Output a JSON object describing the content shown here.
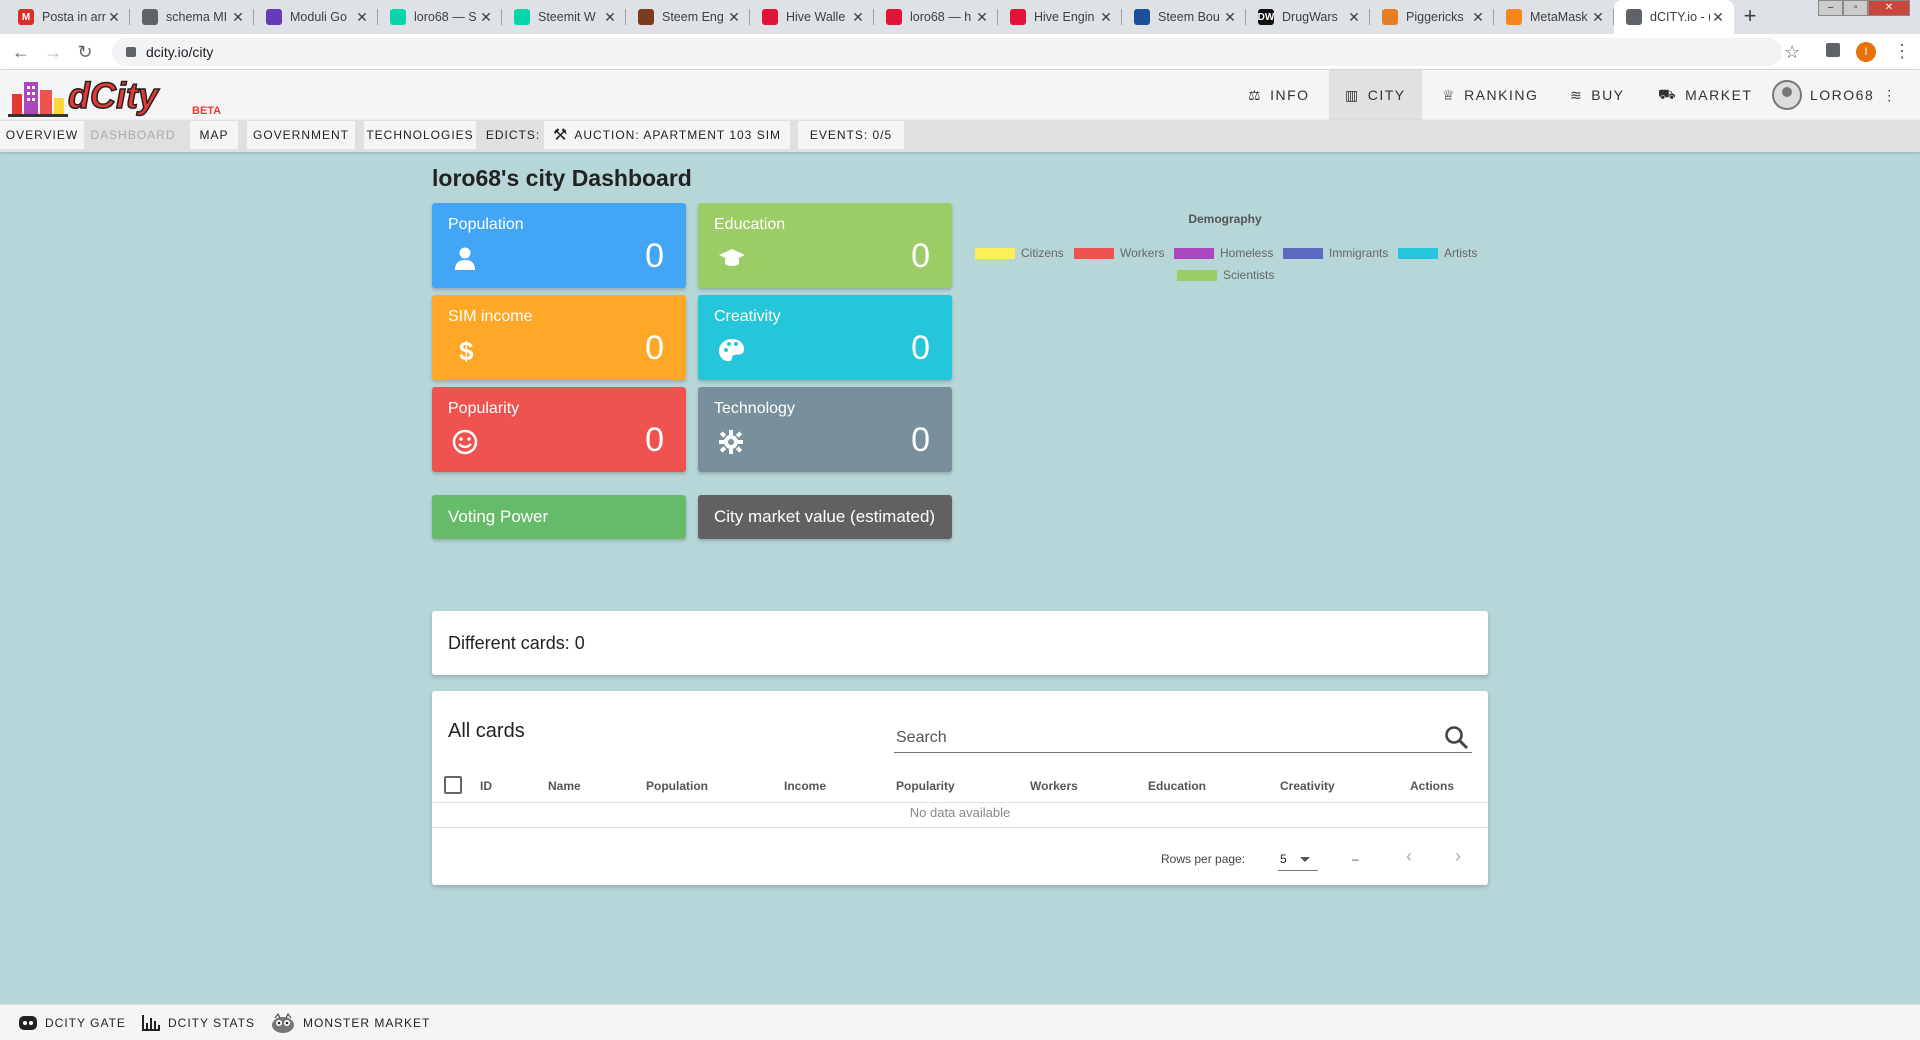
{
  "browser": {
    "tabs": [
      {
        "title": "Posta in arr",
        "icon": "gmail-icon",
        "color": "#d93025",
        "glyph": "M"
      },
      {
        "title": "schema MI",
        "icon": "globe-icon",
        "color": "#5f6368",
        "glyph": ""
      },
      {
        "title": "Moduli Go",
        "icon": "forms-icon",
        "color": "#673ab7",
        "glyph": ""
      },
      {
        "title": "loro68 — S",
        "icon": "steemit-icon",
        "color": "#06d6a9",
        "glyph": ""
      },
      {
        "title": "Steemit W",
        "icon": "steemit-icon",
        "color": "#06d6a9",
        "glyph": ""
      },
      {
        "title": "Steem Eng",
        "icon": "steem-engine-icon",
        "color": "#7a3b1e",
        "glyph": ""
      },
      {
        "title": "Hive Walle",
        "icon": "hive-icon",
        "color": "#e31337",
        "glyph": ""
      },
      {
        "title": "loro68 — h",
        "icon": "hive-icon",
        "color": "#e31337",
        "glyph": ""
      },
      {
        "title": "Hive Engin",
        "icon": "hive-engine-icon",
        "color": "#e31337",
        "glyph": ""
      },
      {
        "title": "Steem Bou",
        "icon": "steem-icon",
        "color": "#1a5099",
        "glyph": ""
      },
      {
        "title": "DrugWars",
        "icon": "drugwars-icon",
        "color": "#111111",
        "glyph": "DW"
      },
      {
        "title": "Piggericks",
        "icon": "pig-icon",
        "color": "#e67e22",
        "glyph": ""
      },
      {
        "title": "MetaMask",
        "icon": "metamask-icon",
        "color": "#f6851b",
        "glyph": ""
      },
      {
        "title": "dCITY.io - (",
        "icon": "dcity-icon",
        "color": "#5f6368",
        "glyph": ""
      }
    ],
    "url": "dcity.io/city",
    "profile_initial": "I"
  },
  "header": {
    "logo_text": "dCity",
    "logo_badge": "BETA",
    "nav": [
      {
        "label": "INFO",
        "icon": "scale-icon",
        "glyph": "⚖"
      },
      {
        "label": "CITY",
        "icon": "city-icon",
        "glyph": "▥"
      },
      {
        "label": "RANKING",
        "icon": "trophy-icon",
        "glyph": "🏆"
      },
      {
        "label": "BUY",
        "icon": "coins-icon",
        "glyph": "≋"
      },
      {
        "label": "MARKET",
        "icon": "cart-icon",
        "glyph": "🛒"
      }
    ],
    "user": "LORO68"
  },
  "subnav": {
    "overview": "OVERVIEW",
    "dashboard": "DASHBOARD",
    "map": "MAP",
    "government": "GOVERNMENT",
    "technologies": "TECHNOLOGIES",
    "edicts": "EDICTS:",
    "auction": "AUCTION: APARTMENT 103 SIM",
    "events": "EVENTS: 0/5"
  },
  "main": {
    "title": "loro68's city Dashboard",
    "stats": [
      {
        "label": "Population",
        "value": "0",
        "icon": "person-icon",
        "color": "#42a5f5"
      },
      {
        "label": "Education",
        "value": "0",
        "icon": "graduation-cap-icon",
        "color": "#9ccc65"
      },
      {
        "label": "SIM income",
        "value": "0",
        "icon": "dollar-icon",
        "color": "#ffa726"
      },
      {
        "label": "Creativity",
        "value": "0",
        "icon": "palette-icon",
        "color": "#26c6da"
      },
      {
        "label": "Popularity",
        "value": "0",
        "icon": "smile-icon",
        "color": "#ef5350"
      },
      {
        "label": "Technology",
        "value": "0",
        "icon": "gear-icon",
        "color": "#78909c"
      }
    ],
    "voting_power": "Voting Power",
    "market_value": "City market value (estimated)",
    "demography": {
      "title": "Demography",
      "legend": [
        {
          "name": "Citizens",
          "color": "#ffee58"
        },
        {
          "name": "Workers",
          "color": "#ef5350"
        },
        {
          "name": "Homeless",
          "color": "#ab47bc"
        },
        {
          "name": "Immigrants",
          "color": "#5c6bc0"
        },
        {
          "name": "Artists",
          "color": "#26c6da"
        },
        {
          "name": "Scientists",
          "color": "#9ccc65"
        }
      ]
    },
    "different_cards": "Different cards: 0",
    "all_cards": {
      "title": "All cards",
      "search_placeholder": "Search",
      "columns": [
        "ID",
        "Name",
        "Population",
        "Income",
        "Popularity",
        "Workers",
        "Education",
        "Creativity",
        "Actions"
      ],
      "empty": "No data available",
      "rows_per_page_label": "Rows per page:",
      "rows_per_page": "5",
      "page_range": "–"
    }
  },
  "footer": {
    "links": [
      {
        "label": "DCITY GATE",
        "icon": "discord-icon"
      },
      {
        "label": "DCITY STATS",
        "icon": "bar-chart-icon"
      },
      {
        "label": "MONSTER MARKET",
        "icon": "monster-icon"
      }
    ]
  }
}
